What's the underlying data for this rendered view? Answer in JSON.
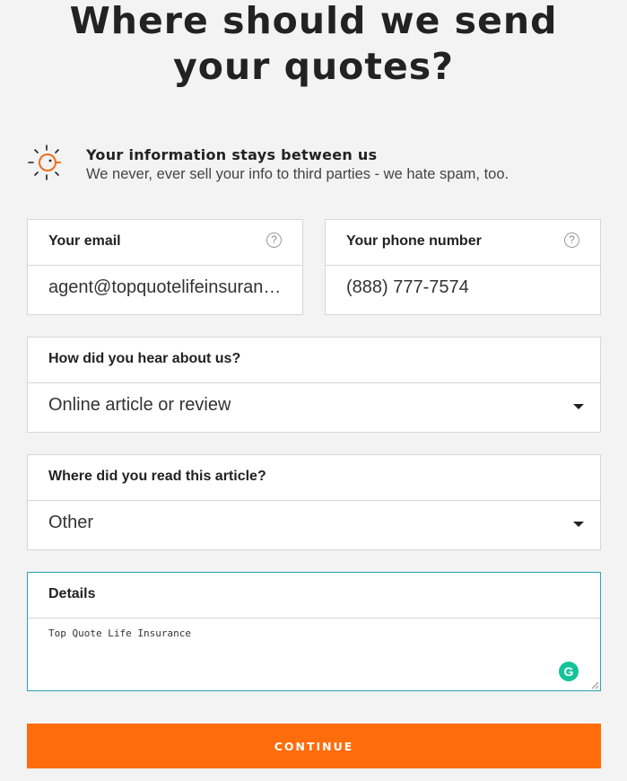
{
  "page": {
    "title_line1": "Where should we send",
    "title_line2": "your quotes?"
  },
  "privacy": {
    "heading": "Your information stays between us",
    "subtext": "We never, ever sell your info to third parties - we hate spam, too.",
    "icon": "sun-face-icon",
    "icon_color": "#f26a1b"
  },
  "email": {
    "label": "Your email",
    "value": "agent@topquotelifeinsurance.com",
    "help": "?"
  },
  "phone": {
    "label": "Your phone number",
    "value": "(888) 777-7574",
    "help": "?"
  },
  "hear": {
    "label": "How did you hear about us?",
    "selected": "Online article or review"
  },
  "article": {
    "label": "Where did you read this article?",
    "selected": "Other"
  },
  "details": {
    "label": "Details",
    "value": "Top Quote Life Insurance",
    "grammarly_icon": "G"
  },
  "continue": {
    "label": "CONTINUE",
    "color": "#ff6c0c"
  }
}
